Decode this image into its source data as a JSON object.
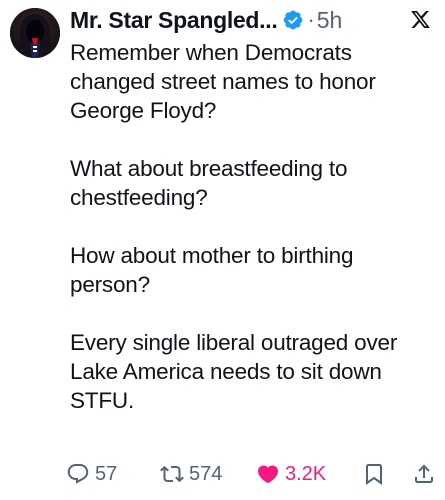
{
  "author": {
    "display_name": "Mr. Star Spangled...",
    "separator": "·",
    "time_ago": "5h",
    "avatar_icon": "hooded-figure-avatar",
    "verified_color": "#1d9bf0"
  },
  "tweet": {
    "paragraphs": [
      "Remember when Democrats changed street names to honor George Floyd?",
      "What about breastfeeding to chestfeeding?",
      "How about mother to birthing person?",
      "Every single liberal outraged over Lake America needs to sit down STFU."
    ]
  },
  "actions": {
    "replies": "57",
    "reposts": "574",
    "likes": "3.2K",
    "like_color": "#f91880",
    "muted_color": "#536471"
  }
}
